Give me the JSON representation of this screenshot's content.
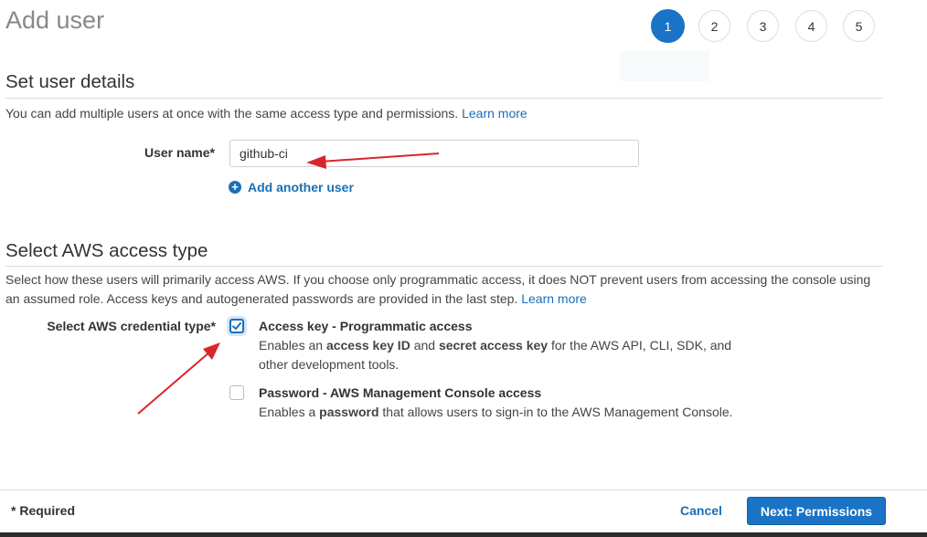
{
  "page_title": "Add user",
  "steps": [
    {
      "label": "1",
      "active": true
    },
    {
      "label": "2",
      "active": false
    },
    {
      "label": "3",
      "active": false
    },
    {
      "label": "4",
      "active": false
    },
    {
      "label": "5",
      "active": false
    }
  ],
  "details": {
    "title": "Set user details",
    "description": "You can add multiple users at once with the same access type and permissions.",
    "learn_more": "Learn more",
    "user_name_label": "User name*",
    "user_name_value": "github-ci",
    "add_another_user": "Add another user"
  },
  "access": {
    "title": "Select AWS access type",
    "description": "Select how these users will primarily access AWS. If you choose only programmatic access, it does NOT prevent users from accessing the console using an assumed role. Access keys and autogenerated passwords are provided in the last step.",
    "learn_more": "Learn more",
    "credential_label": "Select AWS credential type*",
    "options": [
      {
        "title": "Access key - Programmatic access",
        "desc_parts": [
          "Enables an ",
          "access key ID",
          " and ",
          "secret access key",
          " for the AWS API, CLI, SDK, and other development tools."
        ],
        "checked": true
      },
      {
        "title": "Password - AWS Management Console access",
        "desc_parts": [
          "Enables a ",
          "password",
          " that allows users to sign-in to the AWS Management Console."
        ],
        "checked": false
      }
    ]
  },
  "footer": {
    "required": "* Required",
    "cancel": "Cancel",
    "next": "Next: Permissions"
  },
  "colors": {
    "accent": "#1a73c5",
    "link": "#1a6fb8",
    "annotation_arrow": "#d9262b"
  }
}
